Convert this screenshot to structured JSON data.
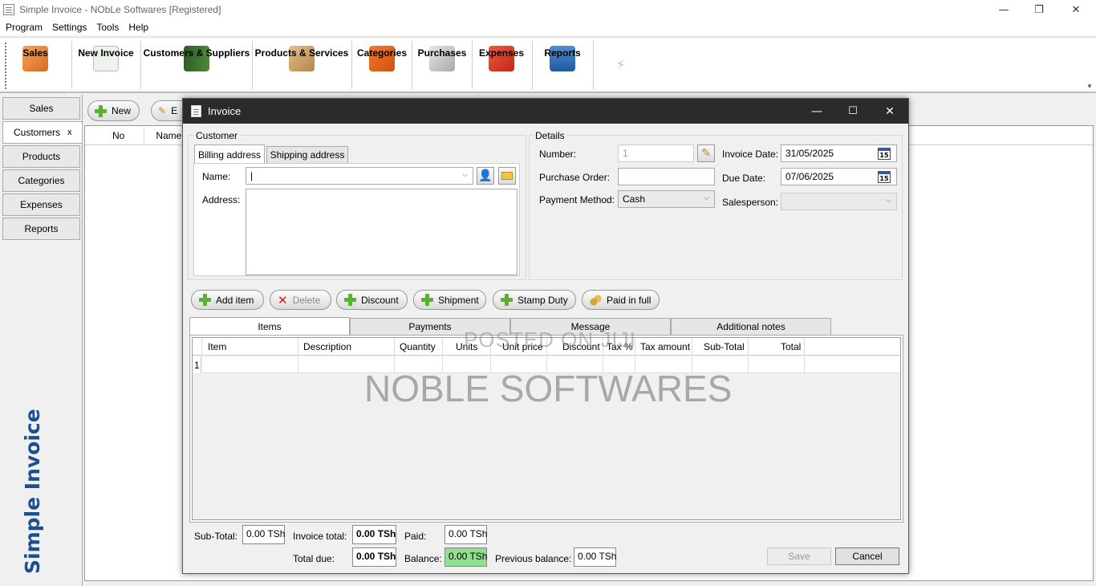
{
  "window": {
    "title": "Simple Invoice - NObLe Softwares   [Registered]",
    "minimize": "—",
    "restore": "❐",
    "close": "✕"
  },
  "menu": [
    "Program",
    "Settings",
    "Tools",
    "Help"
  ],
  "toolbar": [
    {
      "label": "Sales",
      "icon": "sales-folder-icon",
      "color": "#e88a3a"
    },
    {
      "label": "New Invoice",
      "icon": "new-invoice-icon",
      "color": "#dfe8dc"
    },
    {
      "label": "Customers & Suppliers",
      "icon": "address-book-icon",
      "color": "#3d6b2f"
    },
    {
      "label": "Products & Services",
      "icon": "box-icon",
      "color": "#c9a06a"
    },
    {
      "label": "Categories",
      "icon": "categories-icon",
      "color": "#e0641c"
    },
    {
      "label": "Purchases",
      "icon": "shopping-cart-icon",
      "color": "#bdbdbd"
    },
    {
      "label": "Expenses",
      "icon": "coins-stack-icon",
      "color": "#d83a22"
    },
    {
      "label": "Reports",
      "icon": "chart-report-icon",
      "color": "#2d6bb0"
    }
  ],
  "sidebar": {
    "tabs": [
      "Sales",
      "Customers",
      "Products",
      "Categories",
      "Expenses",
      "Reports"
    ],
    "active_close": "x",
    "brand": "Simple Invoice"
  },
  "background_panel": {
    "new_label": "New",
    "edit_label": "E",
    "columns": [
      "No",
      "Name"
    ]
  },
  "dialog": {
    "title": "Invoice",
    "customer": {
      "group": "Customer",
      "tabs": [
        "Billing address",
        "Shipping address"
      ],
      "name_label": "Name:",
      "name_value": "|",
      "address_label": "Address:"
    },
    "details": {
      "group": "Details",
      "number_label": "Number:",
      "number_value": "1",
      "po_label": "Purchase Order:",
      "po_value": "",
      "payment_label": "Payment Method:",
      "payment_value": "Cash",
      "invoice_date_label": "Invoice Date:",
      "invoice_date_value": "31/05/2025",
      "due_date_label": "Due Date:",
      "due_date_value": "07/06/2025",
      "salesperson_label": "Salesperson:",
      "salesperson_value": "",
      "calendar_day": "15"
    },
    "actions": [
      "Add item",
      "Delete",
      "Discount",
      "Shipment",
      "Stamp Duty",
      "Paid in full"
    ],
    "tabs": [
      "Items",
      "Payments",
      "Message",
      "Additional notes"
    ],
    "columns": [
      "Item",
      "Description",
      "Quantity",
      "Units",
      "Unit price",
      "Discount",
      "Tax %",
      "Tax amount",
      "Sub-Total",
      "Total"
    ],
    "row_number": "1",
    "watermark_small": "POSTED ON JIJI",
    "watermark_big": "NOBLE SOFTWARES",
    "totals": {
      "subtotal_label": "Sub-Total:",
      "subtotal_value": "0.00 TSh",
      "invoice_total_label": "Invoice total:",
      "invoice_total_value": "0.00 TSh",
      "paid_label": "Paid:",
      "paid_value": "0.00 TSh",
      "total_due_label": "Total due:",
      "total_due_value": "0.00 TSh",
      "balance_label": "Balance:",
      "balance_value": "0.00 TSh",
      "previous_balance_label": "Previous balance:",
      "previous_balance_value": "0.00 TSh"
    },
    "save_label": "Save",
    "cancel_label": "Cancel",
    "balance_color": "#8fe08f"
  }
}
